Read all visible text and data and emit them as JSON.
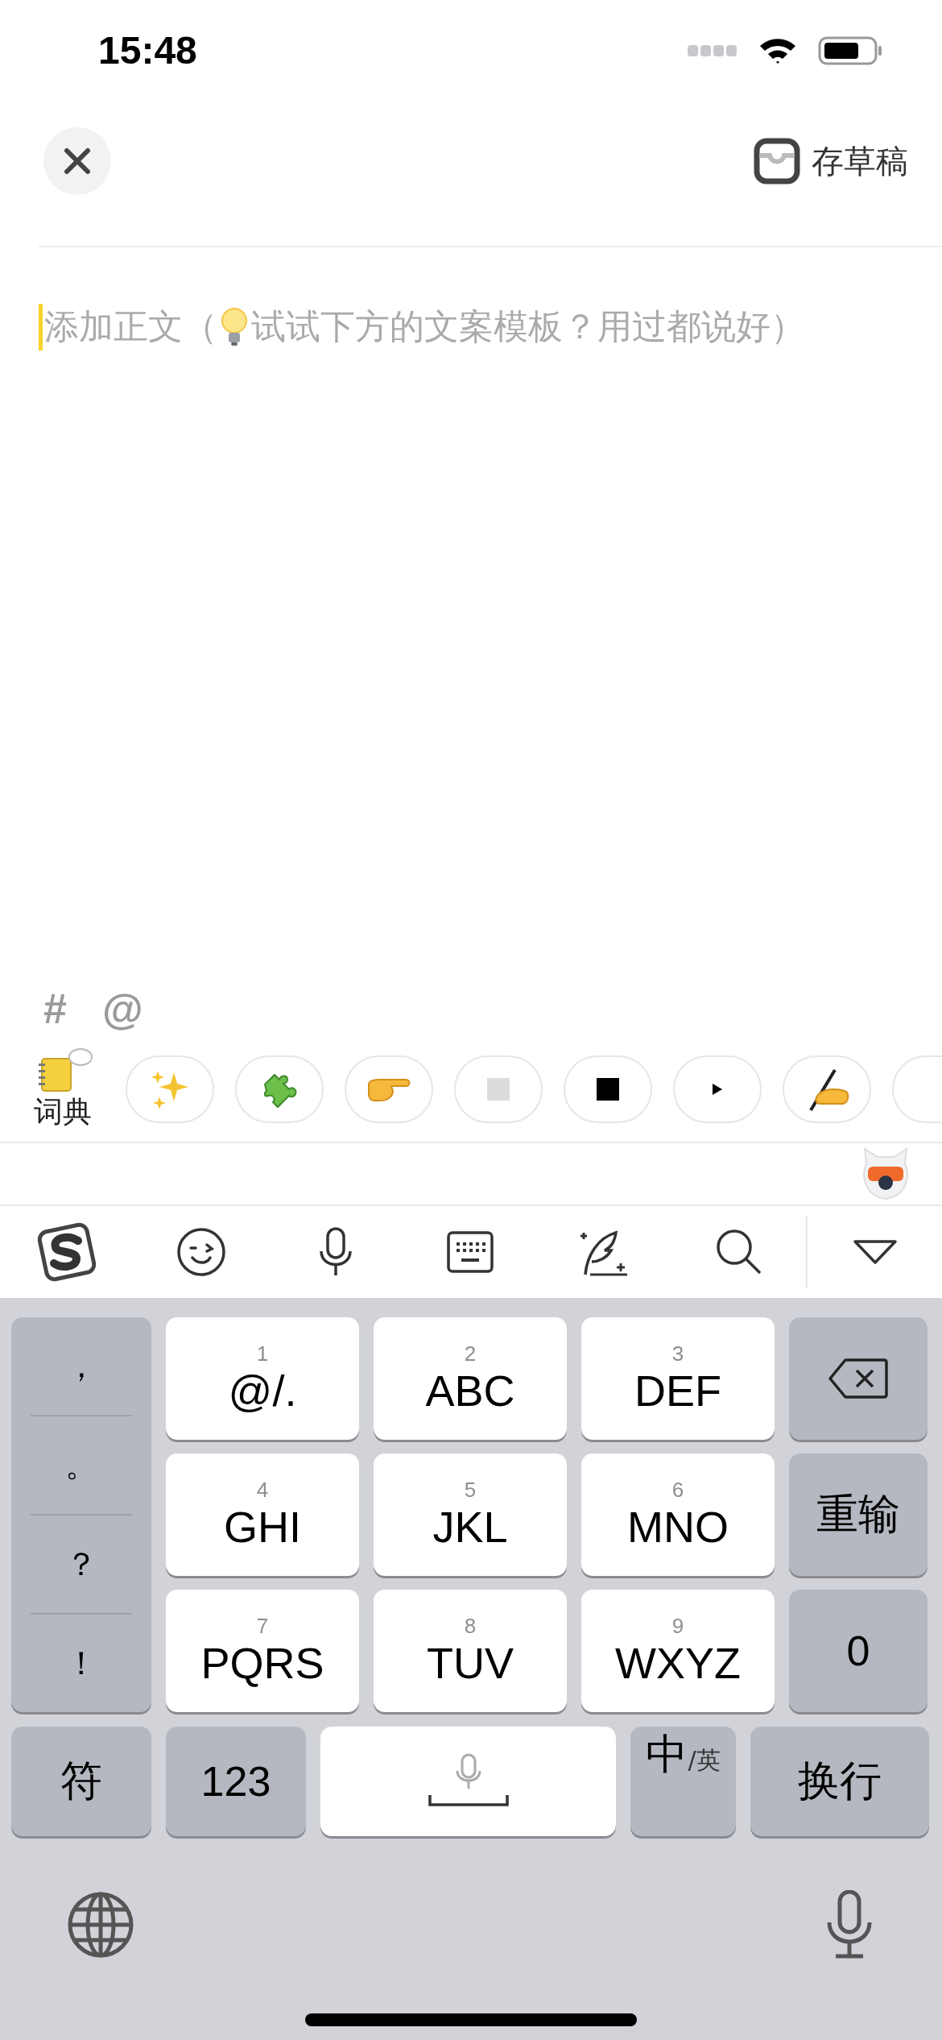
{
  "status_bar": {
    "time": "15:48"
  },
  "header": {
    "save_draft": "存草稿"
  },
  "body": {
    "hint_before": "添加正文（",
    "hint_after": "试试下方的文案模板？用过都说好）"
  },
  "insert_bar": {
    "hashtag": "#",
    "mention": "@"
  },
  "dictionary": {
    "label": "词典"
  },
  "templates": [
    {
      "kind": "sparkles"
    },
    {
      "kind": "puzzle"
    },
    {
      "kind": "pointing-hand"
    },
    {
      "kind": "grey-square"
    },
    {
      "kind": "black-square"
    },
    {
      "kind": "triangle"
    },
    {
      "kind": "writing-hand"
    },
    {
      "kind": "partial"
    }
  ],
  "keyboard": {
    "punctuation": [
      "，",
      "。",
      "？",
      "！"
    ],
    "keys": [
      {
        "number": "1",
        "letters": "@/."
      },
      {
        "number": "2",
        "letters": "ABC"
      },
      {
        "number": "3",
        "letters": "DEF"
      },
      {
        "number": "4",
        "letters": "GHI"
      },
      {
        "number": "5",
        "letters": "JKL"
      },
      {
        "number": "6",
        "letters": "MNO"
      },
      {
        "number": "7",
        "letters": "PQRS"
      },
      {
        "number": "8",
        "letters": "TUV"
      },
      {
        "number": "9",
        "letters": "WXYZ"
      }
    ],
    "reset": "重输",
    "zero": "0",
    "symbols": "符",
    "numbers": "123",
    "language_main": "中",
    "language_alt": "/英",
    "return": "换行"
  }
}
